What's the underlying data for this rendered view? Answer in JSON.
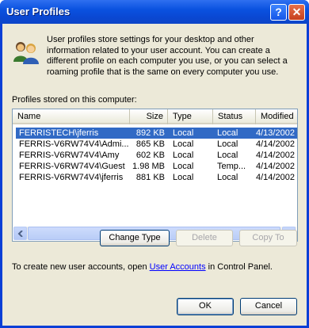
{
  "window": {
    "title": "User Profiles",
    "help_button": "?",
    "close_button": "✕"
  },
  "intro": {
    "text": "User profiles store settings for your desktop and other information related to your user account. You can create a different profile on each computer you use, or you can select a roaming profile that is the same on every computer you use."
  },
  "profiles": {
    "label": "Profiles stored on this computer:",
    "columns": [
      "Name",
      "Size",
      "Type",
      "Status",
      "Modified"
    ],
    "rows": [
      {
        "name": "FERRISTECH\\jferris",
        "size": "892 KB",
        "type": "Local",
        "status": "Local",
        "modified": "4/13/2002",
        "selected": true
      },
      {
        "name": "FERRIS-V6RW74V4\\Admi...",
        "size": "865 KB",
        "type": "Local",
        "status": "Local",
        "modified": "4/14/2002",
        "selected": false
      },
      {
        "name": "FERRIS-V6RW74V4\\Amy",
        "size": "602 KB",
        "type": "Local",
        "status": "Local",
        "modified": "4/14/2002",
        "selected": false
      },
      {
        "name": "FERRIS-V6RW74V4\\Guest",
        "size": "1.98 MB",
        "type": "Local",
        "status": "Temp...",
        "modified": "4/14/2002",
        "selected": false
      },
      {
        "name": "FERRIS-V6RW74V4\\jferris",
        "size": "881 KB",
        "type": "Local",
        "status": "Local",
        "modified": "4/14/2002",
        "selected": false
      }
    ]
  },
  "actions": {
    "change_type": "Change Type",
    "delete": "Delete",
    "copy_to": "Copy To"
  },
  "create": {
    "prefix": "To create new user accounts, open ",
    "link": "User Accounts",
    "suffix": " in Control Panel."
  },
  "footer": {
    "ok": "OK",
    "cancel": "Cancel"
  },
  "colors": {
    "selection": "#316ac5",
    "titlebar": "#0a52e0",
    "dialog_bg": "#ece9d8"
  }
}
